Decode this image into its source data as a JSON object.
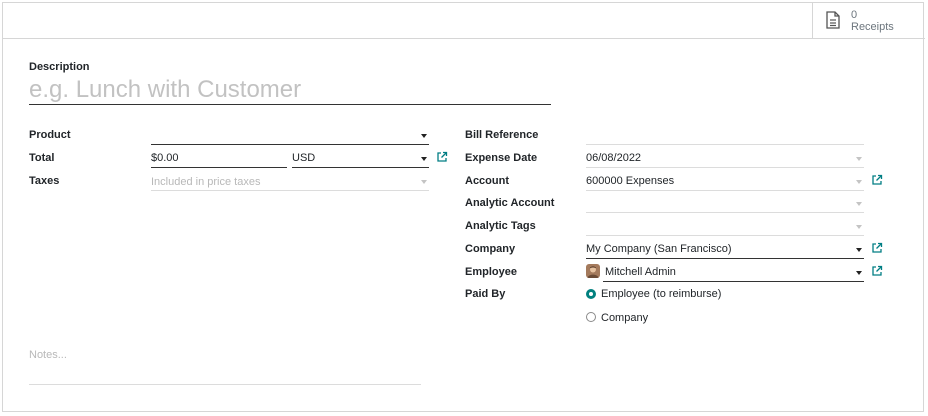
{
  "button_box": {
    "receipts_count": "0",
    "receipts_label": "Receipts"
  },
  "description": {
    "label": "Description",
    "placeholder": "e.g. Lunch with Customer"
  },
  "left": {
    "product_label": "Product",
    "total_label": "Total",
    "total_value": "$0.00",
    "currency": "USD",
    "taxes_label": "Taxes",
    "taxes_placeholder": "Included in price taxes"
  },
  "right": {
    "bill_reference_label": "Bill Reference",
    "expense_date_label": "Expense Date",
    "expense_date_value": "06/08/2022",
    "account_label": "Account",
    "account_value": "600000 Expenses",
    "analytic_account_label": "Analytic Account",
    "analytic_tags_label": "Analytic Tags",
    "company_label": "Company",
    "company_value": "My Company (San Francisco)",
    "employee_label": "Employee",
    "employee_value": "Mitchell Admin",
    "paid_by_label": "Paid By",
    "paid_by_options": [
      "Employee (to reimburse)",
      "Company"
    ],
    "paid_by_selected": "Employee (to reimburse)"
  },
  "notes": {
    "placeholder": "Notes..."
  },
  "colors": {
    "accent": "#01807f",
    "link_icon": "#017e84"
  },
  "icons": [
    "document-icon",
    "external-link-icon",
    "caret-down-icon",
    "avatar"
  ]
}
